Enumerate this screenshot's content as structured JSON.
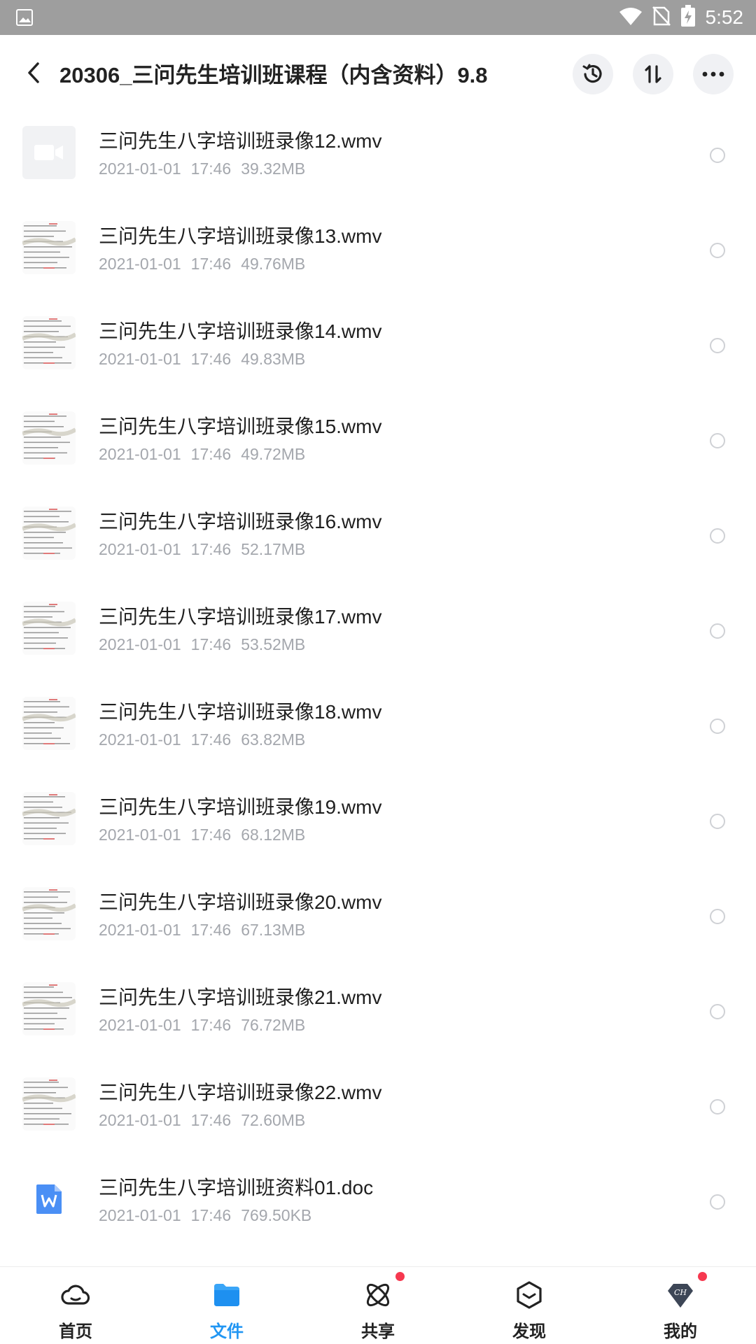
{
  "status_bar": {
    "time": "5:52",
    "icons": [
      "image-icon",
      "wifi-icon",
      "no-sim-icon",
      "battery-charging-icon"
    ]
  },
  "header": {
    "title": "20306_三问先生培训班课程（内含资料）9.8",
    "back_icon": "back-arrow-icon",
    "actions": [
      "history-icon",
      "sort-icon",
      "more-icon"
    ]
  },
  "files": [
    {
      "name": "三问先生八字培训班录像12.wmv",
      "date": "2021-01-01",
      "time": "17:46",
      "size": "39.32MB",
      "thumb": "video-placeholder-icon"
    },
    {
      "name": "三问先生八字培训班录像13.wmv",
      "date": "2021-01-01",
      "time": "17:46",
      "size": "49.76MB",
      "thumb": "document-scan-thumbnail"
    },
    {
      "name": "三问先生八字培训班录像14.wmv",
      "date": "2021-01-01",
      "time": "17:46",
      "size": "49.83MB",
      "thumb": "document-scan-thumbnail"
    },
    {
      "name": "三问先生八字培训班录像15.wmv",
      "date": "2021-01-01",
      "time": "17:46",
      "size": "49.72MB",
      "thumb": "document-scan-thumbnail"
    },
    {
      "name": "三问先生八字培训班录像16.wmv",
      "date": "2021-01-01",
      "time": "17:46",
      "size": "52.17MB",
      "thumb": "document-scan-thumbnail"
    },
    {
      "name": "三问先生八字培训班录像17.wmv",
      "date": "2021-01-01",
      "time": "17:46",
      "size": "53.52MB",
      "thumb": "document-scan-thumbnail"
    },
    {
      "name": "三问先生八字培训班录像18.wmv",
      "date": "2021-01-01",
      "time": "17:46",
      "size": "63.82MB",
      "thumb": "document-scan-thumbnail"
    },
    {
      "name": "三问先生八字培训班录像19.wmv",
      "date": "2021-01-01",
      "time": "17:46",
      "size": "68.12MB",
      "thumb": "document-scan-thumbnail"
    },
    {
      "name": "三问先生八字培训班录像20.wmv",
      "date": "2021-01-01",
      "time": "17:46",
      "size": "67.13MB",
      "thumb": "document-scan-thumbnail"
    },
    {
      "name": "三问先生八字培训班录像21.wmv",
      "date": "2021-01-01",
      "time": "17:46",
      "size": "76.72MB",
      "thumb": "document-scan-thumbnail"
    },
    {
      "name": "三问先生八字培训班录像22.wmv",
      "date": "2021-01-01",
      "time": "17:46",
      "size": "72.60MB",
      "thumb": "document-scan-thumbnail"
    },
    {
      "name": "三问先生八字培训班资料01.doc",
      "date": "2021-01-01",
      "time": "17:46",
      "size": "769.50KB",
      "thumb": "word-doc-icon"
    }
  ],
  "bottom_nav": [
    {
      "label": "首页",
      "icon": "cloud-home-icon",
      "active": false,
      "badge": false
    },
    {
      "label": "文件",
      "icon": "folder-icon",
      "active": true,
      "badge": false
    },
    {
      "label": "共享",
      "icon": "share-atom-icon",
      "active": false,
      "badge": true
    },
    {
      "label": "发现",
      "icon": "discover-box-icon",
      "active": false,
      "badge": false
    },
    {
      "label": "我的",
      "icon": "profile-diamond-icon",
      "active": false,
      "badge": true
    }
  ],
  "colors": {
    "accent": "#2196f3",
    "badge": "#f6384f",
    "status_bar": "#9e9e9e",
    "meta_text": "#a4a7ad"
  }
}
